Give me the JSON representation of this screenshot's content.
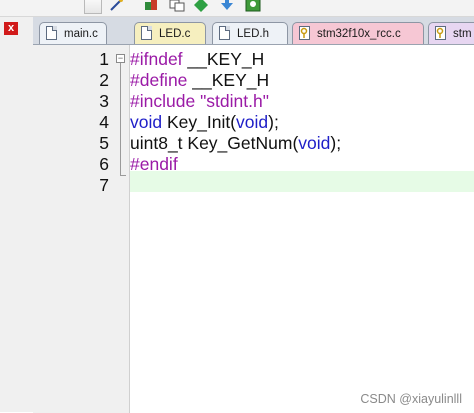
{
  "tabs": [
    {
      "label": "main.c",
      "color": "#eef2f7",
      "icon": "file-icon"
    },
    {
      "label": "LED.c",
      "color": "#f6efbf",
      "icon": "file-icon"
    },
    {
      "label": "LED.h",
      "color": "#eef2f7",
      "icon": "file-icon"
    },
    {
      "label": "stm32f10x_rcc.c",
      "color": "#f6c7d4",
      "icon": "key-file-icon"
    },
    {
      "label": "stm",
      "color": "#e7d6f1",
      "icon": "key-file-icon"
    }
  ],
  "close_label": "x",
  "editor": {
    "lines": [
      {
        "num": "1",
        "tokens": [
          {
            "t": "#ifndef",
            "c": "pp"
          },
          {
            "t": " __KEY_H",
            "c": "txt"
          }
        ]
      },
      {
        "num": "2",
        "tokens": [
          {
            "t": "#define",
            "c": "pp"
          },
          {
            "t": " __KEY_H",
            "c": "txt"
          }
        ]
      },
      {
        "num": "3",
        "tokens": [
          {
            "t": "#include",
            "c": "pp"
          },
          {
            "t": " \"stdint.h\"",
            "c": "str"
          }
        ]
      },
      {
        "num": "4",
        "tokens": [
          {
            "t": "void",
            "c": "kw"
          },
          {
            "t": " Key_Init(",
            "c": "txt"
          },
          {
            "t": "void",
            "c": "kw"
          },
          {
            "t": ");",
            "c": "txt"
          }
        ]
      },
      {
        "num": "5",
        "tokens": [
          {
            "t": "uint8_t Key_GetNum(",
            "c": "txt"
          },
          {
            "t": "void",
            "c": "kw"
          },
          {
            "t": ");",
            "c": "txt"
          }
        ]
      },
      {
        "num": "6",
        "tokens": [
          {
            "t": "#endif",
            "c": "pp"
          }
        ]
      },
      {
        "num": "7",
        "tokens": []
      }
    ]
  },
  "watermark": "CSDN @xiayulinlll",
  "colors": {
    "preprocessor": "#9a1aa6",
    "keyword": "#1e1ec8",
    "current_line": "#e6fbe6"
  }
}
